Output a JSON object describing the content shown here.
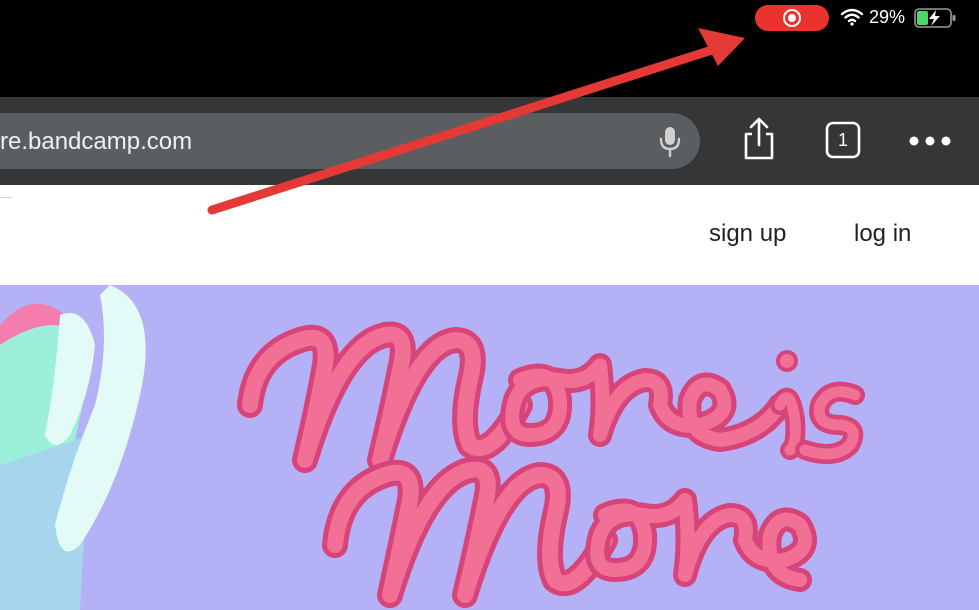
{
  "status_bar": {
    "recording_icon": "screen-recording-icon",
    "wifi_icon": "wifi-icon",
    "battery_percent": "29%",
    "battery_icon": "battery-charging-icon",
    "recording_color": "#e8332f",
    "battery_color": "#4cd964"
  },
  "browser": {
    "url": "re.bandcamp.com",
    "mic_icon": "microphone-icon",
    "share_icon": "share-icon",
    "tab_count": "1",
    "more_icon": "more-icon"
  },
  "site_header": {
    "signup_label": "sign up",
    "login_label": "log in"
  },
  "hero": {
    "artwork_text": "More is More",
    "background_color": "#b5b1f7",
    "lettering_color": "#f0648c"
  },
  "annotation": {
    "arrow_color": "#e53935"
  }
}
